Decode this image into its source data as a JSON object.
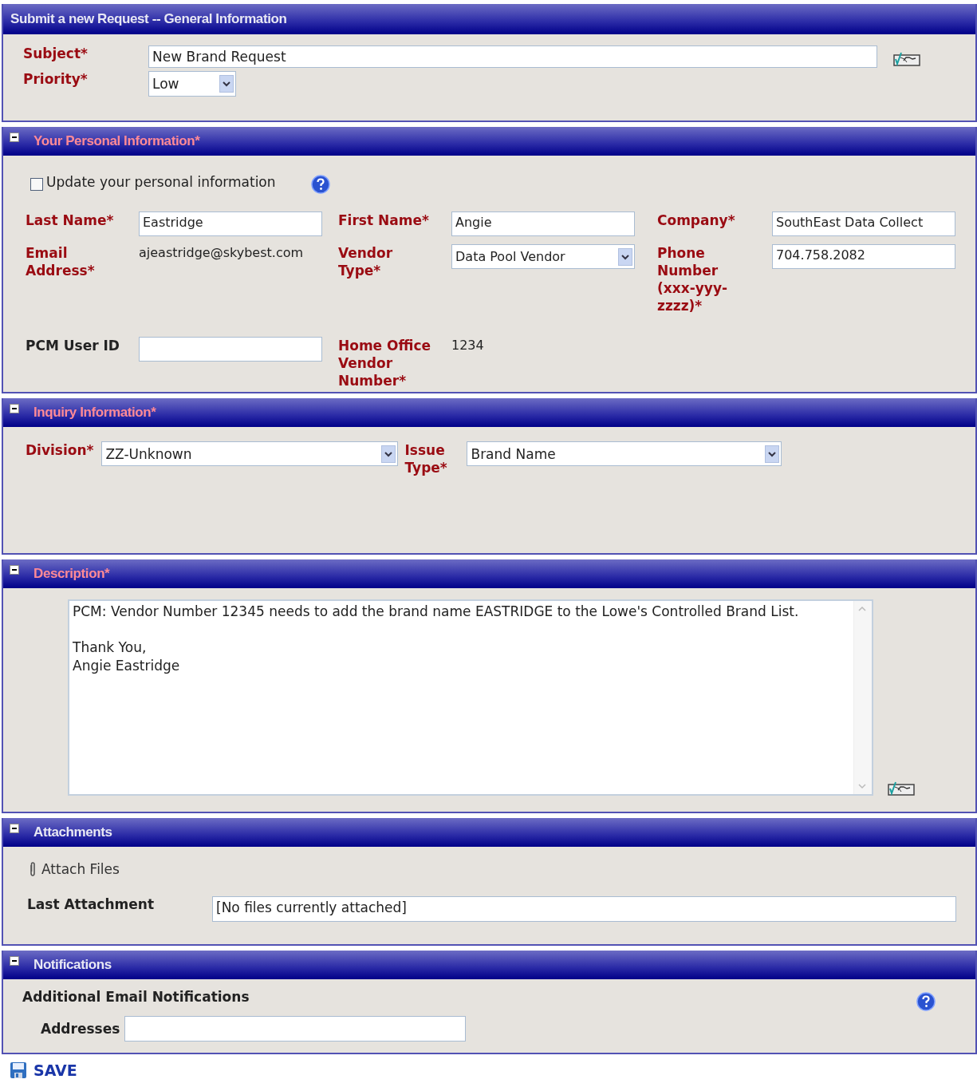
{
  "form_title": "Submit a new Request -- General Information",
  "general": {
    "subject": {
      "label": "Subject*",
      "value": "New Brand Request"
    },
    "priority": {
      "label": "Priority*",
      "value": "Low"
    }
  },
  "sections": [
    {
      "kind": "personal",
      "title": "Your Personal Information*",
      "required": true,
      "expanded": true,
      "update_checkbox": {
        "label": "Update your personal information",
        "checked": false
      },
      "fields": [
        {
          "label": "Last Name*",
          "kind": "text",
          "value": "Eastridge",
          "required": true
        },
        {
          "label": "First Name*",
          "kind": "text",
          "value": "Angie",
          "required": true
        },
        {
          "label": "Company*",
          "kind": "text",
          "value": "SouthEast Data Collect",
          "required": true
        },
        {
          "label": "Email Address*",
          "kind": "static",
          "value": "ajeastridge@skybest.com",
          "required": true
        },
        {
          "label": "Vendor Type*",
          "kind": "select",
          "value": "Data Pool Vendor",
          "required": true
        },
        {
          "label": "Phone Number (xxx-yyy-zzzz)*",
          "kind": "text",
          "value": "704.758.2082",
          "required": true
        },
        {
          "label": "PCM User ID",
          "kind": "text",
          "required": false
        },
        {
          "label": "Home Office Vendor Number*",
          "kind": "static",
          "value": "1234",
          "required": true
        }
      ]
    },
    {
      "kind": "inquiry",
      "title": "Inquiry Information*",
      "required": true,
      "expanded": true,
      "fields": [
        {
          "label": "Division*",
          "kind": "select",
          "value": "ZZ-Unknown",
          "required": true
        },
        {
          "label": "Issue Type*",
          "kind": "select",
          "value": "Brand Name",
          "required": true
        }
      ]
    },
    {
      "kind": "description",
      "title": "Description*",
      "required": true,
      "expanded": true,
      "paragraphs": [
        [
          "PCM: Vendor Number 12345 needs to add the brand name EASTRIDGE to the Lowe's Controlled Brand List."
        ],
        [
          "Thank You,",
          "Angie Eastridge"
        ]
      ]
    },
    {
      "kind": "attachments",
      "title": "Attachments",
      "required": false,
      "expanded": true,
      "attach_link": "Attach Files",
      "last_label": "Last Attachment",
      "last_value": "[No files currently attached]"
    },
    {
      "kind": "notifications",
      "title": "Notifications",
      "required": false,
      "expanded": true,
      "heading": "Additional Email Notifications",
      "addresses_label": "Addresses"
    }
  ],
  "save_button": "SAVE"
}
